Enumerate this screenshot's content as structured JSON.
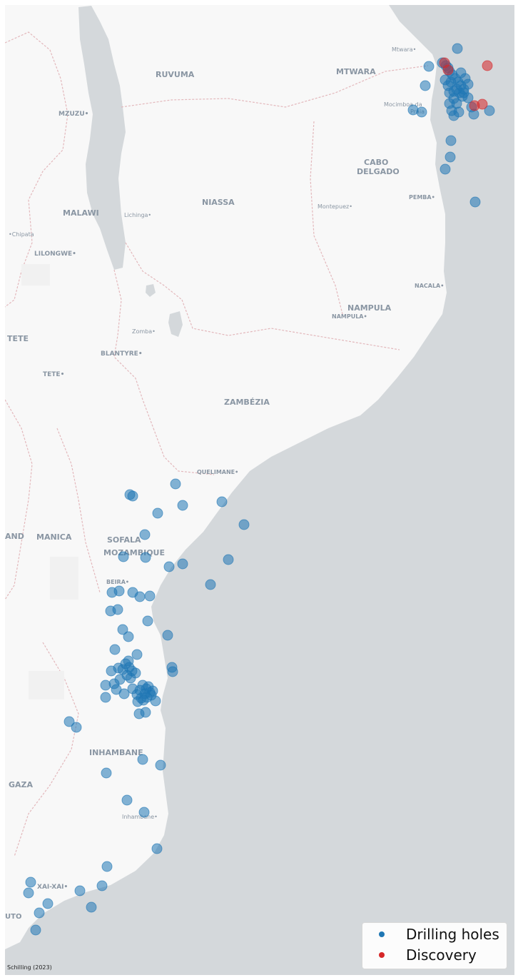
{
  "map": {
    "region_labels": [
      {
        "id": "ruvuma",
        "text": "RUVUMA"
      },
      {
        "id": "mtwara-region",
        "text": "MTWARA"
      },
      {
        "id": "mzuzu",
        "text": "MZUZU•"
      },
      {
        "id": "cabo",
        "text": "CABO"
      },
      {
        "id": "delgado",
        "text": "DELGADO"
      },
      {
        "id": "niassa",
        "text": "NIASSA"
      },
      {
        "id": "malawi",
        "text": "MALAWI"
      },
      {
        "id": "lichinga",
        "text": "Lichinga•"
      },
      {
        "id": "montepuez",
        "text": "Montepuez•"
      },
      {
        "id": "pemba",
        "text": "PEMBA•"
      },
      {
        "id": "chipata",
        "text": "•Chipata"
      },
      {
        "id": "lilongwe",
        "text": "LILONGWE•"
      },
      {
        "id": "nacala",
        "text": "NACALA•"
      },
      {
        "id": "nampula-region",
        "text": "NAMPULA"
      },
      {
        "id": "nampula-city",
        "text": "NAMPULA•"
      },
      {
        "id": "tete-region",
        "text": "TETE"
      },
      {
        "id": "zomba",
        "text": "Zomba•"
      },
      {
        "id": "blantyre",
        "text": "BLANTYRE•"
      },
      {
        "id": "tete-city",
        "text": "TETE•"
      },
      {
        "id": "zambezia",
        "text": "ZAMBÉZIA"
      },
      {
        "id": "quelimane",
        "text": "QUELIMANE•"
      },
      {
        "id": "and",
        "text": "AND"
      },
      {
        "id": "manica",
        "text": "MANICA"
      },
      {
        "id": "sofala",
        "text": "SOFALA"
      },
      {
        "id": "mozambique",
        "text": "MOZAMBIQUE"
      },
      {
        "id": "beira",
        "text": "BEIRA•"
      },
      {
        "id": "inhambane-region",
        "text": "INHAMBANE"
      },
      {
        "id": "gaza",
        "text": "GAZA"
      },
      {
        "id": "inhambane-city",
        "text": "Inhambane•"
      },
      {
        "id": "xai-xai",
        "text": "XAI-XAI•"
      },
      {
        "id": "uto",
        "text": "UTO"
      },
      {
        "id": "mtwara-city",
        "text": "Mtwara•"
      },
      {
        "id": "mocimboa",
        "text": "Mocimboa da"
      },
      {
        "id": "praia",
        "text": "Praia"
      }
    ],
    "drilling_holes": [
      [
        641,
        68
      ],
      [
        601,
        93
      ],
      [
        596,
        120
      ],
      [
        579,
        154
      ],
      [
        591,
        157
      ],
      [
        624,
        237
      ],
      [
        631,
        220
      ],
      [
        632,
        197
      ],
      [
        666,
        283
      ],
      [
        686,
        155
      ],
      [
        661,
        150
      ],
      [
        664,
        160
      ],
      [
        630,
        100
      ],
      [
        634,
        105
      ],
      [
        638,
        110
      ],
      [
        642,
        115
      ],
      [
        646,
        120
      ],
      [
        650,
        125
      ],
      [
        628,
        95
      ],
      [
        632,
        115
      ],
      [
        640,
        125
      ],
      [
        644,
        130
      ],
      [
        648,
        135
      ],
      [
        652,
        110
      ],
      [
        656,
        118
      ],
      [
        620,
        88
      ],
      [
        625,
        92
      ],
      [
        630,
        130
      ],
      [
        636,
        138
      ],
      [
        640,
        145
      ],
      [
        633,
        155
      ],
      [
        636,
        162
      ],
      [
        643,
        157
      ],
      [
        630,
        145
      ],
      [
        650,
        130
      ],
      [
        656,
        137
      ],
      [
        646,
        102
      ],
      [
        624,
        112
      ],
      [
        628,
        120
      ],
      [
        636,
        128
      ],
      [
        246,
        678
      ],
      [
        182,
        693
      ],
      [
        186,
        695
      ],
      [
        256,
        708
      ],
      [
        311,
        703
      ],
      [
        221,
        719
      ],
      [
        342,
        735
      ],
      [
        203,
        749
      ],
      [
        204,
        781
      ],
      [
        173,
        780
      ],
      [
        237,
        794
      ],
      [
        256,
        790
      ],
      [
        320,
        784
      ],
      [
        295,
        819
      ],
      [
        167,
        828
      ],
      [
        157,
        830
      ],
      [
        186,
        830
      ],
      [
        196,
        836
      ],
      [
        210,
        835
      ],
      [
        165,
        854
      ],
      [
        155,
        856
      ],
      [
        207,
        870
      ],
      [
        172,
        882
      ],
      [
        180,
        892
      ],
      [
        235,
        890
      ],
      [
        161,
        910
      ],
      [
        192,
        917
      ],
      [
        176,
        930
      ],
      [
        181,
        935
      ],
      [
        185,
        940
      ],
      [
        172,
        938
      ],
      [
        190,
        943
      ],
      [
        168,
        952
      ],
      [
        156,
        940
      ],
      [
        166,
        936
      ],
      [
        180,
        926
      ],
      [
        178,
        946
      ],
      [
        183,
        950
      ],
      [
        200,
        960
      ],
      [
        205,
        965
      ],
      [
        210,
        970
      ],
      [
        196,
        967
      ],
      [
        203,
        972
      ],
      [
        192,
        973
      ],
      [
        208,
        962
      ],
      [
        214,
        968
      ],
      [
        198,
        978
      ],
      [
        201,
        981
      ],
      [
        186,
        965
      ],
      [
        174,
        972
      ],
      [
        193,
        983
      ],
      [
        206,
        977
      ],
      [
        212,
        974
      ],
      [
        148,
        960
      ],
      [
        160,
        958
      ],
      [
        163,
        966
      ],
      [
        148,
        977
      ],
      [
        241,
        935
      ],
      [
        242,
        941
      ],
      [
        195,
        1000
      ],
      [
        204,
        998
      ],
      [
        218,
        982
      ],
      [
        97,
        1011
      ],
      [
        107,
        1019
      ],
      [
        200,
        1064
      ],
      [
        225,
        1072
      ],
      [
        149,
        1083
      ],
      [
        178,
        1121
      ],
      [
        202,
        1138
      ],
      [
        220,
        1189
      ],
      [
        150,
        1214
      ],
      [
        43,
        1236
      ],
      [
        40,
        1251
      ],
      [
        112,
        1248
      ],
      [
        143,
        1241
      ],
      [
        67,
        1266
      ],
      [
        128,
        1271
      ],
      [
        55,
        1279
      ],
      [
        50,
        1303
      ]
    ],
    "discoveries": [
      [
        623,
        88
      ],
      [
        628,
        98
      ],
      [
        683,
        92
      ],
      [
        676,
        146
      ],
      [
        665,
        148
      ]
    ],
    "point_colors": {
      "drilling": "#1f77b4",
      "discovery": "#d62728",
      "land": "#fafafa",
      "water": "#d4d8db"
    }
  },
  "legend": {
    "drilling_label": "Drilling holes",
    "discovery_label": "Discovery",
    "drilling_color": "#1f77b4",
    "discovery_color": "#d62728"
  },
  "attribution": "Schilling (2023)"
}
